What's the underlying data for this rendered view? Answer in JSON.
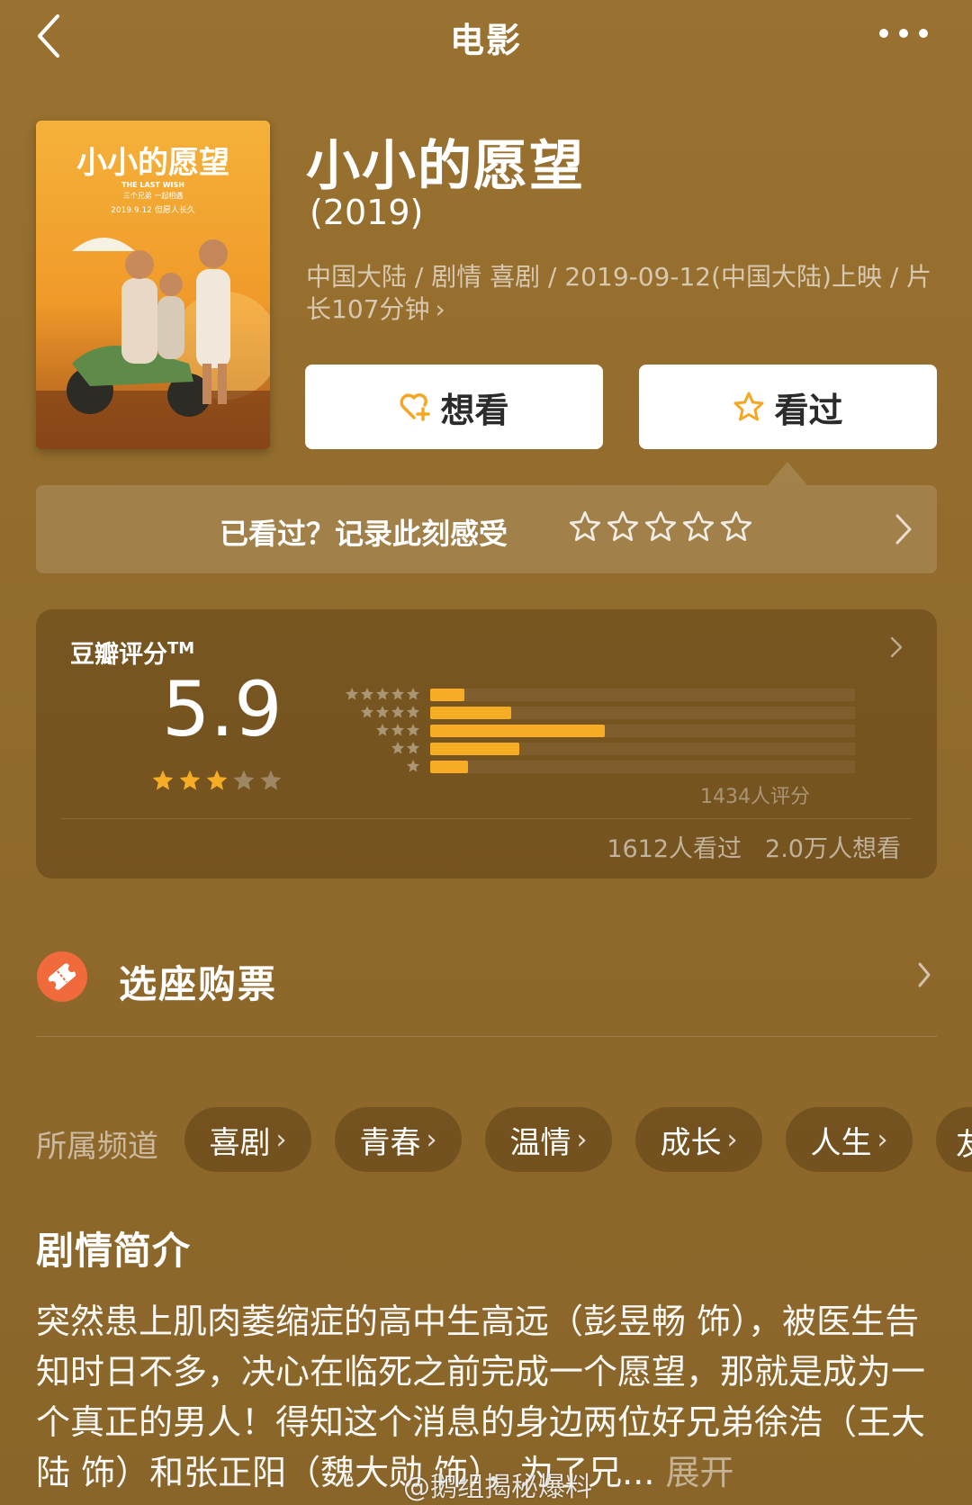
{
  "nav": {
    "title": "电影"
  },
  "movie": {
    "title": "小小的愿望",
    "year": "(2019)",
    "meta": "中国大陆 / 剧情 喜剧 / 2019-09-12(中国大陆)上映 / 片长107分钟",
    "meta_chevron": "›",
    "poster": {
      "title_art": "小小的愿望",
      "subtitle": "THE LAST WISH",
      "tagline": "三个兄弟   一起相遇",
      "release_line": "2019.9.12 但愿人长久"
    }
  },
  "actions": {
    "want_label": "想看",
    "seen_label": "看过"
  },
  "rate_prompt": {
    "text": "已看过？记录此刻感受",
    "star_count": 5
  },
  "douban": {
    "label": "豆瓣评分",
    "tm": "TM",
    "score": "5.9",
    "stars_filled": 3,
    "stars_total": 5,
    "distribution": [
      {
        "stars": 5,
        "fraction": 0.08
      },
      {
        "stars": 4,
        "fraction": 0.19
      },
      {
        "stars": 3,
        "fraction": 0.41
      },
      {
        "stars": 2,
        "fraction": 0.21
      },
      {
        "stars": 1,
        "fraction": 0.09
      }
    ],
    "rating_count": "1434人评分",
    "seen_count": "1612人看过",
    "want_count": "2.0万人想看"
  },
  "ticket": {
    "label": "选座购票"
  },
  "channels": {
    "label": "所属频道",
    "items": [
      "喜剧",
      "青春",
      "温情",
      "成长",
      "人生"
    ],
    "partial": "友"
  },
  "synopsis": {
    "title": "剧情简介",
    "text": "突然患上肌肉萎缩症的高中生高远（彭昱畅 饰），被医生告知时日不多，决心在临死之前完成一个愿望，那就是成为一个真正的男人！得知这个消息的身边两位好兄弟徐浩（王大陆 饰）和张正阳（魏大勋 饰），为了兄...",
    "more": "展开"
  },
  "watermark": "@鹅组揭秘爆料",
  "colors": {
    "accent": "#f7ac26",
    "background": "#946c2c",
    "ticket_icon": "#f06a3c"
  }
}
